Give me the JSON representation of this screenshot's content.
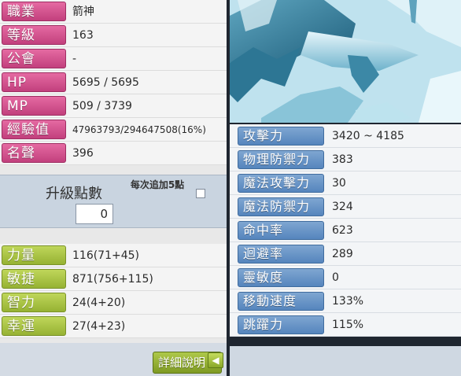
{
  "character_info": {
    "rows": [
      {
        "label": "職業",
        "value": "箭神"
      },
      {
        "label": "等級",
        "value": "163"
      },
      {
        "label": "公會",
        "value": "-"
      },
      {
        "label": "HP",
        "value": "5695 / 5695"
      },
      {
        "label": "MP",
        "value": "509 / 3739"
      },
      {
        "label": "經驗值",
        "value": "47963793/294647508(16%)"
      },
      {
        "label": "名聲",
        "value": "396"
      }
    ]
  },
  "level_up": {
    "title": "升級點數",
    "points": "0",
    "auto_add_label": "每次追加5點"
  },
  "stats": {
    "rows": [
      {
        "label": "力量",
        "value": "116(71+45)"
      },
      {
        "label": "敏捷",
        "value": "871(756+115)"
      },
      {
        "label": "智力",
        "value": "24(4+20)"
      },
      {
        "label": "幸運",
        "value": "27(4+23)"
      }
    ]
  },
  "detail_button": {
    "label": "詳細說明",
    "arrow": "▶"
  },
  "attack_stats": {
    "rows": [
      {
        "label": "攻擊力",
        "value": "3420 ~ 4185"
      },
      {
        "label": "物理防禦力",
        "value": "383"
      },
      {
        "label": "魔法攻擊力",
        "value": "30"
      },
      {
        "label": "魔法防禦力",
        "value": "324"
      },
      {
        "label": "命中率",
        "value": "623"
      },
      {
        "label": "迴避率",
        "value": "289"
      },
      {
        "label": "靈敏度",
        "value": "0"
      },
      {
        "label": "移動速度",
        "value": "133%"
      },
      {
        "label": "跳躍力",
        "value": "115%"
      }
    ]
  },
  "back_button": {
    "icon": "back-arrow-icon",
    "glyph": "◀"
  },
  "colors": {
    "pink_label": "#d2548f",
    "green_label": "#a6c03f",
    "blue_label": "#6a95c7"
  }
}
